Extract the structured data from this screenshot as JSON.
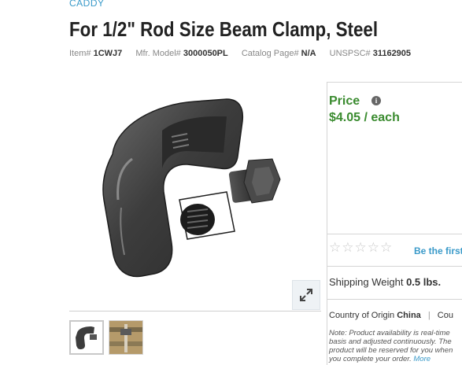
{
  "brand": "CADDY",
  "title": "For 1/2\" Rod Size Beam Clamp, Steel",
  "meta": {
    "item_label": "Item#",
    "item_value": "1CWJ7",
    "model_label": "Mfr. Model#",
    "model_value": "3000050PL",
    "catalog_label": "Catalog Page#",
    "catalog_value": "N/A",
    "unspsc_label": "UNSPSC#",
    "unspsc_value": "31162905"
  },
  "price": {
    "label": "Price",
    "info_icon": "info-icon",
    "value": "$4.05 / each"
  },
  "rating": {
    "stars_filled": 0,
    "stars_total": 5,
    "stars_text": "☆☆☆☆☆",
    "review_link": "Be the first"
  },
  "shipping": {
    "label": "Shipping Weight",
    "value": "0.5 lbs."
  },
  "origin": {
    "label": "Country of Origin",
    "value": "China",
    "separator": "|",
    "extra": "Cou"
  },
  "note": {
    "text": "Note: Product availability is real-time basis and adjusted continuously. The product will be reserved for you when you complete your order.",
    "more_link": "More"
  },
  "icons": {
    "expand": "expand-icon"
  },
  "colors": {
    "brand_blue": "#3a9ac9",
    "price_green": "#3a8b2f"
  }
}
